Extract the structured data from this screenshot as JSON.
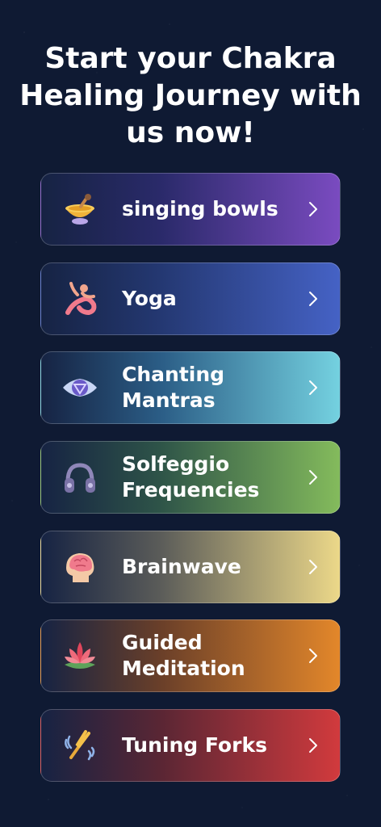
{
  "title": "Start your Chakra\nHealing Journey with\nus now!",
  "items": [
    {
      "label": "singing bowls",
      "icon": "singing-bowl-icon",
      "color": "#7a4bc0"
    },
    {
      "label": "Yoga",
      "icon": "yoga-pose-icon",
      "color": "#4562c5"
    },
    {
      "label": "Chanting\nMantras",
      "icon": "chakra-gem-icon",
      "color": "#74d1e0"
    },
    {
      "label": "Solfeggio\nFrequencies",
      "icon": "headphones-icon",
      "color": "#84bb5c"
    },
    {
      "label": "Brainwave",
      "icon": "head-brain-icon",
      "color": "#ecd889"
    },
    {
      "label": "Guided\nMeditation",
      "icon": "lotus-icon",
      "color": "#e3872a"
    },
    {
      "label": "Tuning Forks",
      "icon": "tuning-fork-icon",
      "color": "#d13a3d"
    }
  ]
}
